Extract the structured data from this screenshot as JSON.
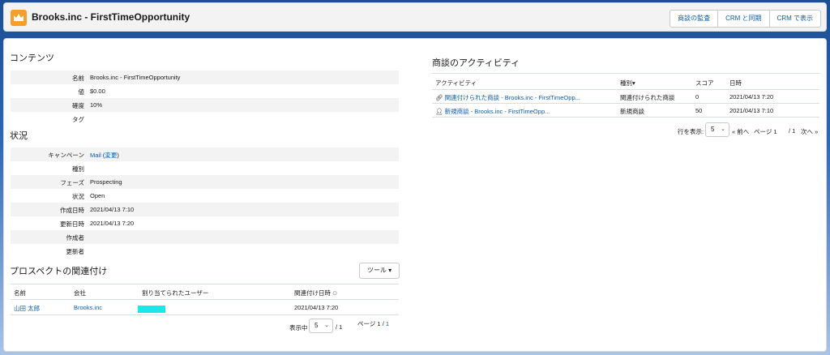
{
  "header": {
    "title": "Brooks.inc - FirstTimeOpportunity",
    "buttons": [
      "商談の監査",
      "CRM と同期",
      "CRM で表示"
    ]
  },
  "contents": {
    "heading": "コンテンツ",
    "rows": [
      {
        "label": "名前",
        "value": "Brooks.inc - FirstTimeOpportunity"
      },
      {
        "label": "値",
        "value": "$0.00"
      },
      {
        "label": "確度",
        "value": "10%"
      },
      {
        "label": "タグ",
        "value": ""
      }
    ]
  },
  "status": {
    "heading": "状況",
    "campaign": {
      "label": "キャンペーン",
      "value": "Mail",
      "change": "変更"
    },
    "rows": [
      {
        "label": "種別",
        "value": ""
      },
      {
        "label": "フェーズ",
        "value": "Prospecting"
      },
      {
        "label": "状況",
        "value": "Open"
      },
      {
        "label": "作成日時",
        "value": "2021/04/13 7:10"
      },
      {
        "label": "更新日時",
        "value": "2021/04/13 7:20"
      },
      {
        "label": "作成者",
        "value": ""
      },
      {
        "label": "更新者",
        "value": ""
      }
    ]
  },
  "prospects": {
    "heading": "プロスペクトの関連付け",
    "tools_label": "ツール",
    "columns": [
      "名前",
      "会社",
      "割り当てられたユーザー",
      "関連付け日時"
    ],
    "rows": [
      {
        "name": "山田 太郎",
        "company": "Brooks.inc",
        "user": "",
        "date": "2021/04/13 7:20"
      }
    ],
    "per_page_label": "表示中",
    "per_page": "5",
    "per_page_total": "/ 1",
    "page_label": "ページ 1 /",
    "page_total": "1"
  },
  "activity": {
    "heading": "商談のアクティビティ",
    "columns": [
      "アクティビティ",
      "種別",
      "スコア",
      "日時"
    ],
    "rows": [
      {
        "activity": "関連付けられた商談 - Brooks.inc - FirstTimeOpp...",
        "type": "関連付けられた商談",
        "score": "0",
        "date": "2021/04/13 7:20",
        "icon": "link-icon"
      },
      {
        "activity": "新規商談 - Brooks.inc - FirstTimeOpp...",
        "type": "新規商談",
        "score": "50",
        "date": "2021/04/13 7:10",
        "icon": "person-icon"
      }
    ],
    "rows_label": "行を表示:",
    "rows_value": "5",
    "prev": "« 前へ",
    "page_label": "ページ 1",
    "page_total": "/ 1",
    "next": "次へ »"
  },
  "colors": {
    "link": "#0b5cab",
    "accent_redaction": "#18e8e8",
    "logo": "#f59e2a"
  }
}
